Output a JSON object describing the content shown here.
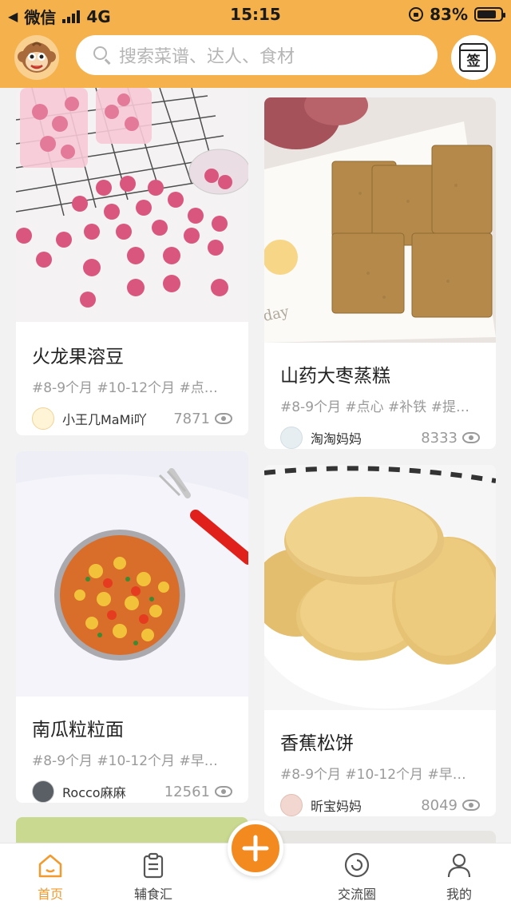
{
  "status_bar": {
    "back_app": "微信",
    "network": "4G",
    "time": "15:15",
    "battery": "83%",
    "battery_level": 0.83
  },
  "search": {
    "placeholder": "搜索菜谱、达人、食材"
  },
  "sign_in": {
    "label": "签"
  },
  "cards": [
    {
      "title": "火龙果溶豆",
      "tags": "#8-9个月  #10-12个月  #点…",
      "user": "小王几MaMi吖",
      "views": "7871"
    },
    {
      "title": "山药大枣蒸糕",
      "tags": "#8-9个月  #点心  #补铁  #提…",
      "user": "淘淘妈妈",
      "views": "8333"
    },
    {
      "title": "南瓜粒粒面",
      "tags": "#8-9个月  #10-12个月  #早…",
      "user": "Rocco麻麻",
      "views": "12561"
    },
    {
      "title": "香蕉松饼",
      "tags": "#8-9个月  #10-12个月  #早…",
      "user": "昕宝妈妈",
      "views": "8049"
    }
  ],
  "tabbar": {
    "items": [
      {
        "label": "首页",
        "active": true
      },
      {
        "label": "辅食汇",
        "active": false
      },
      {
        "label": "交流圈",
        "active": false
      },
      {
        "label": "我的",
        "active": false
      }
    ]
  },
  "colors": {
    "brand": "#f5b14b",
    "accent": "#f28a1f",
    "tab_active": "#f39a2e"
  }
}
